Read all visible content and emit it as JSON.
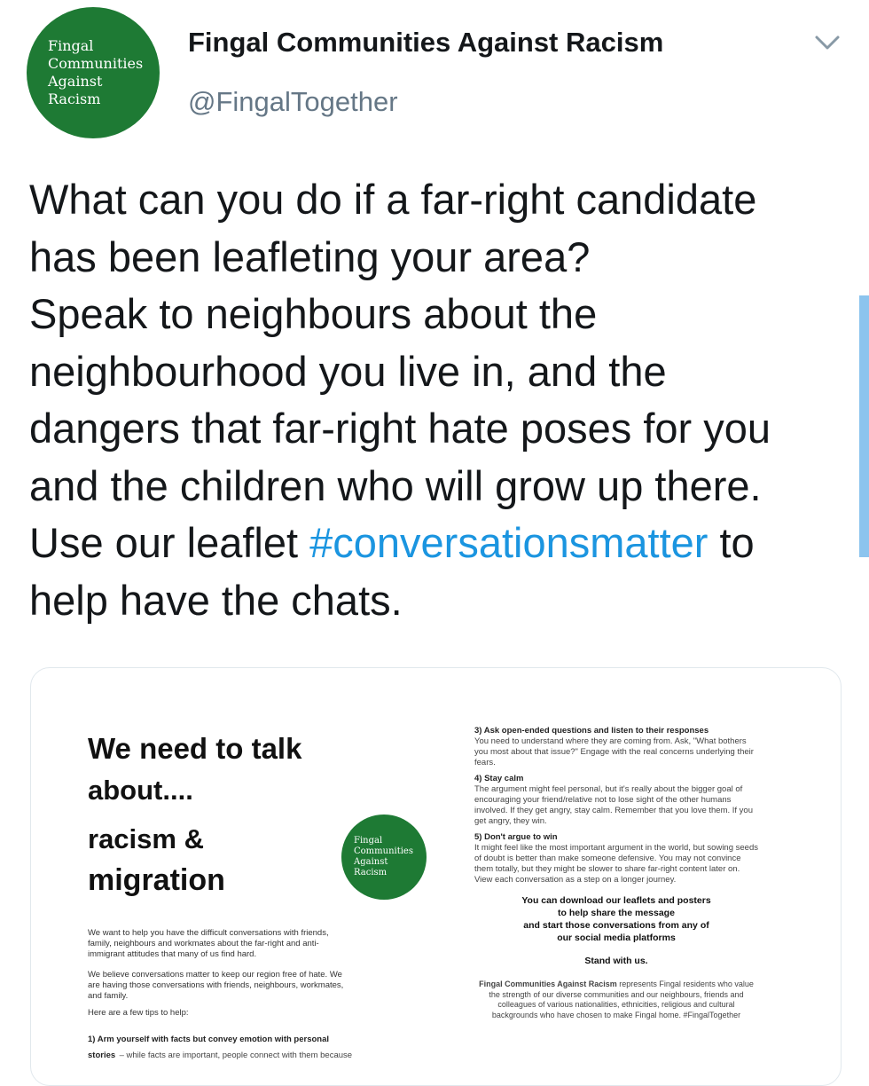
{
  "tweet": {
    "avatar_lines": [
      "Fingal",
      "Communities",
      "Against",
      "Racism"
    ],
    "display_name": "Fingal Communities Against Racism",
    "handle": "@FingalTogether",
    "text_lines": [
      "What can you do if a far-right candidate",
      "has been leafleting your area?",
      "Speak to neighbours about the",
      "neighbourhood you live in, and the",
      "dangers that far-right hate poses for you",
      "and the children who will grow up there."
    ],
    "line7_before": "Use our leaflet ",
    "hashtag": "#conversationsmatter",
    "line7_after": " to",
    "line8": "help have the chats."
  },
  "leaflet": {
    "heading": [
      "We need to talk",
      "about....",
      "racism &",
      "migration"
    ],
    "logo_lines": [
      "Fingal",
      "Communities",
      "Against",
      "Racism"
    ],
    "intro": "We want to help you have the difficult conversations with friends, family, neighbours and workmates about the far-right and anti-immigrant attitudes that many of us find hard.",
    "belief": "We believe conversations matter to keep our region free of hate. We are having those conversations with friends, neighbours, workmates, and family.",
    "tips_intro": "Here are a few tips to help:",
    "tip1_title": "1) Arm yourself with facts but convey emotion with personal stories",
    "tip1_body": "– while facts are important, people connect with them because",
    "tip3_title": "3) Ask open-ended questions and listen to their responses",
    "tip3_body": "You need to understand where they are coming from. Ask, \"What bothers you most about that issue?\" Engage with the real concerns underlying their fears.",
    "tip4_title": "4) Stay calm",
    "tip4_body": "The argument might feel personal, but it's really about the bigger goal of encouraging your friend/relative not to lose sight of the other humans involved. If they get angry, stay calm. Remember that you love them. If you get angry, they win.",
    "tip5_title": "5) Don't argue to win",
    "tip5_body": "It might feel like the most important argument in the world, but sowing seeds of doubt is better than make someone defensive. You may not convince them totally, but they might be slower to share far-right content later on. View each conversation as a step on a longer journey.",
    "download_lines": [
      "You can download our leaflets and posters",
      "to help share the message",
      "and start those conversations from any of",
      "our social media platforms"
    ],
    "stand": "Stand with us.",
    "footer_bold": "Fingal Communities Against Racism",
    "footer_rest": " represents Fingal residents who value the strength of our diverse communities and our neighbours, friends and colleagues of various nationalities, ethnicities, religious and cultural backgrounds who have chosen to make Fingal home. #FingalTogether"
  }
}
